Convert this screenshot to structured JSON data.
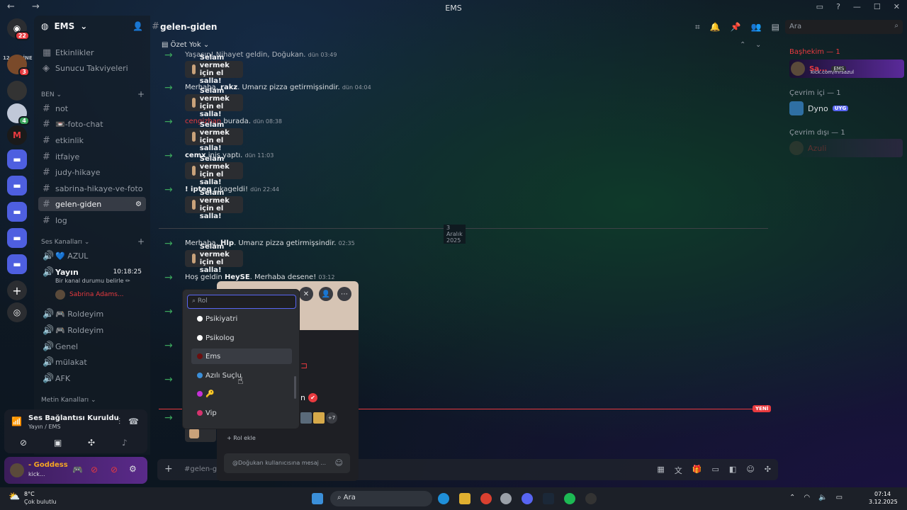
{
  "window": {
    "title": "EMS",
    "nav": "← →"
  },
  "servers": {
    "dm_badge": "22",
    "online_label": "12 ONLİNE",
    "badge2": "3",
    "badge3": "4"
  },
  "server": {
    "name": "EMS"
  },
  "sidebar": {
    "top": [
      {
        "label": "Etkinlikler"
      },
      {
        "label": "Sunucu Takviyeleri"
      }
    ],
    "cat_ben": "BEN",
    "text_channels": [
      "not",
      "📼-foto-chat",
      "etkinlik",
      "itfaiye",
      "judy-hikaye",
      "sabrina-hikaye-ve-foto",
      "gelen-giden",
      "log"
    ],
    "cat_voice": "Ses Kanalları",
    "voice": [
      {
        "label": "💙 AZUL"
      },
      {
        "label": "Yayın",
        "time": "10:18:25",
        "status": "Bir kanal durumu belirle ✏",
        "member": "Sabrina Adams..."
      },
      {
        "label": "🎮 Roldeyim"
      },
      {
        "label": "🎮 Roldeyim"
      },
      {
        "label": "Genel"
      },
      {
        "label": "mülakat"
      },
      {
        "label": "AFK"
      }
    ],
    "cat_text": "Metin Kanalları"
  },
  "voice_panel": {
    "status": "Ses Bağlantısı Kuruldu",
    "sub": "Yayın / EMS"
  },
  "user_panel": {
    "name": "- Goddess",
    "status": "kick..."
  },
  "header": {
    "channel": "gelen-giden",
    "summary": "Özet Yok"
  },
  "search": {
    "placeholder": "Ara"
  },
  "messages": [
    {
      "text": "Yaşasın! Nihayet geldin, Doğukan.",
      "time": "dün 03:49",
      "wave": "Selam vermek için el salla!"
    },
    {
      "pre": "Merhaba, ",
      "name": "rakz",
      "post": ". Umarız pizza getirmişsindir.",
      "time": "dün 04:04",
      "wave": "Selam vermek için el salla!"
    },
    {
      "name": "cengizhan",
      "post": " burada.",
      "time": "dün 08:38",
      "wave": "Selam vermek için el salla!"
    },
    {
      "name": "cemx",
      "post": " iniş yaptı.",
      "time": "dün 11:03",
      "wave": "Selam vermek için el salla!"
    },
    {
      "name": "! ipteq",
      "post": " çıkageldi!",
      "time": "dün 22:44",
      "wave": "Selam vermek için el salla!"
    },
    {
      "pre": "Merhaba, ",
      "name": "ᕼlp",
      "post": ". Umarız pizza getirmişsindir.",
      "time": "02:35",
      "wave": "Selam vermek için el salla!"
    },
    {
      "pre": "Hoş geldin ",
      "name": "HeySE",
      "post": ". Merhaba desene!",
      "time": "03:12"
    }
  ],
  "date_divider": "3 Aralık 2025",
  "new_tag": "YENİ",
  "input": {
    "placeholder": "#gelen-gid"
  },
  "members": {
    "group1": "Başhekim — 1",
    "m1_name": "Sa...",
    "m1_tag": "EMS",
    "m1_status": "kick.com/mrsazul",
    "group2": "Çevrim içi — 1",
    "m2_name": "Dyno",
    "m2_tag": "UYG",
    "group3": "Çevrim dışı — 1",
    "m3_name": "Azuli"
  },
  "popup": {
    "more": "+7",
    "add_role": "Rol ekle",
    "msg_placeholder": "@Doğukan kullanıcısına mesaj ...",
    "name_frag": "n",
    "badge": "✔"
  },
  "role_menu": {
    "search_placeholder": "Rol",
    "roles": [
      {
        "label": "Psikiyatri",
        "color": "#ffffff"
      },
      {
        "label": "Psikolog",
        "color": "#ffffff"
      },
      {
        "label": "Ems",
        "color": "#6b0f0f"
      },
      {
        "label": "Azılı Suçlu",
        "color": "#3b8fd9"
      },
      {
        "label": "🔑",
        "color": "#c530d8"
      },
      {
        "label": "Vip",
        "color": "#d6336c"
      }
    ]
  },
  "taskbar": {
    "temp": "8°C",
    "weather": "Çok bulutlu",
    "search": "Ara",
    "time": "07:14",
    "date": "3.12.2025"
  }
}
